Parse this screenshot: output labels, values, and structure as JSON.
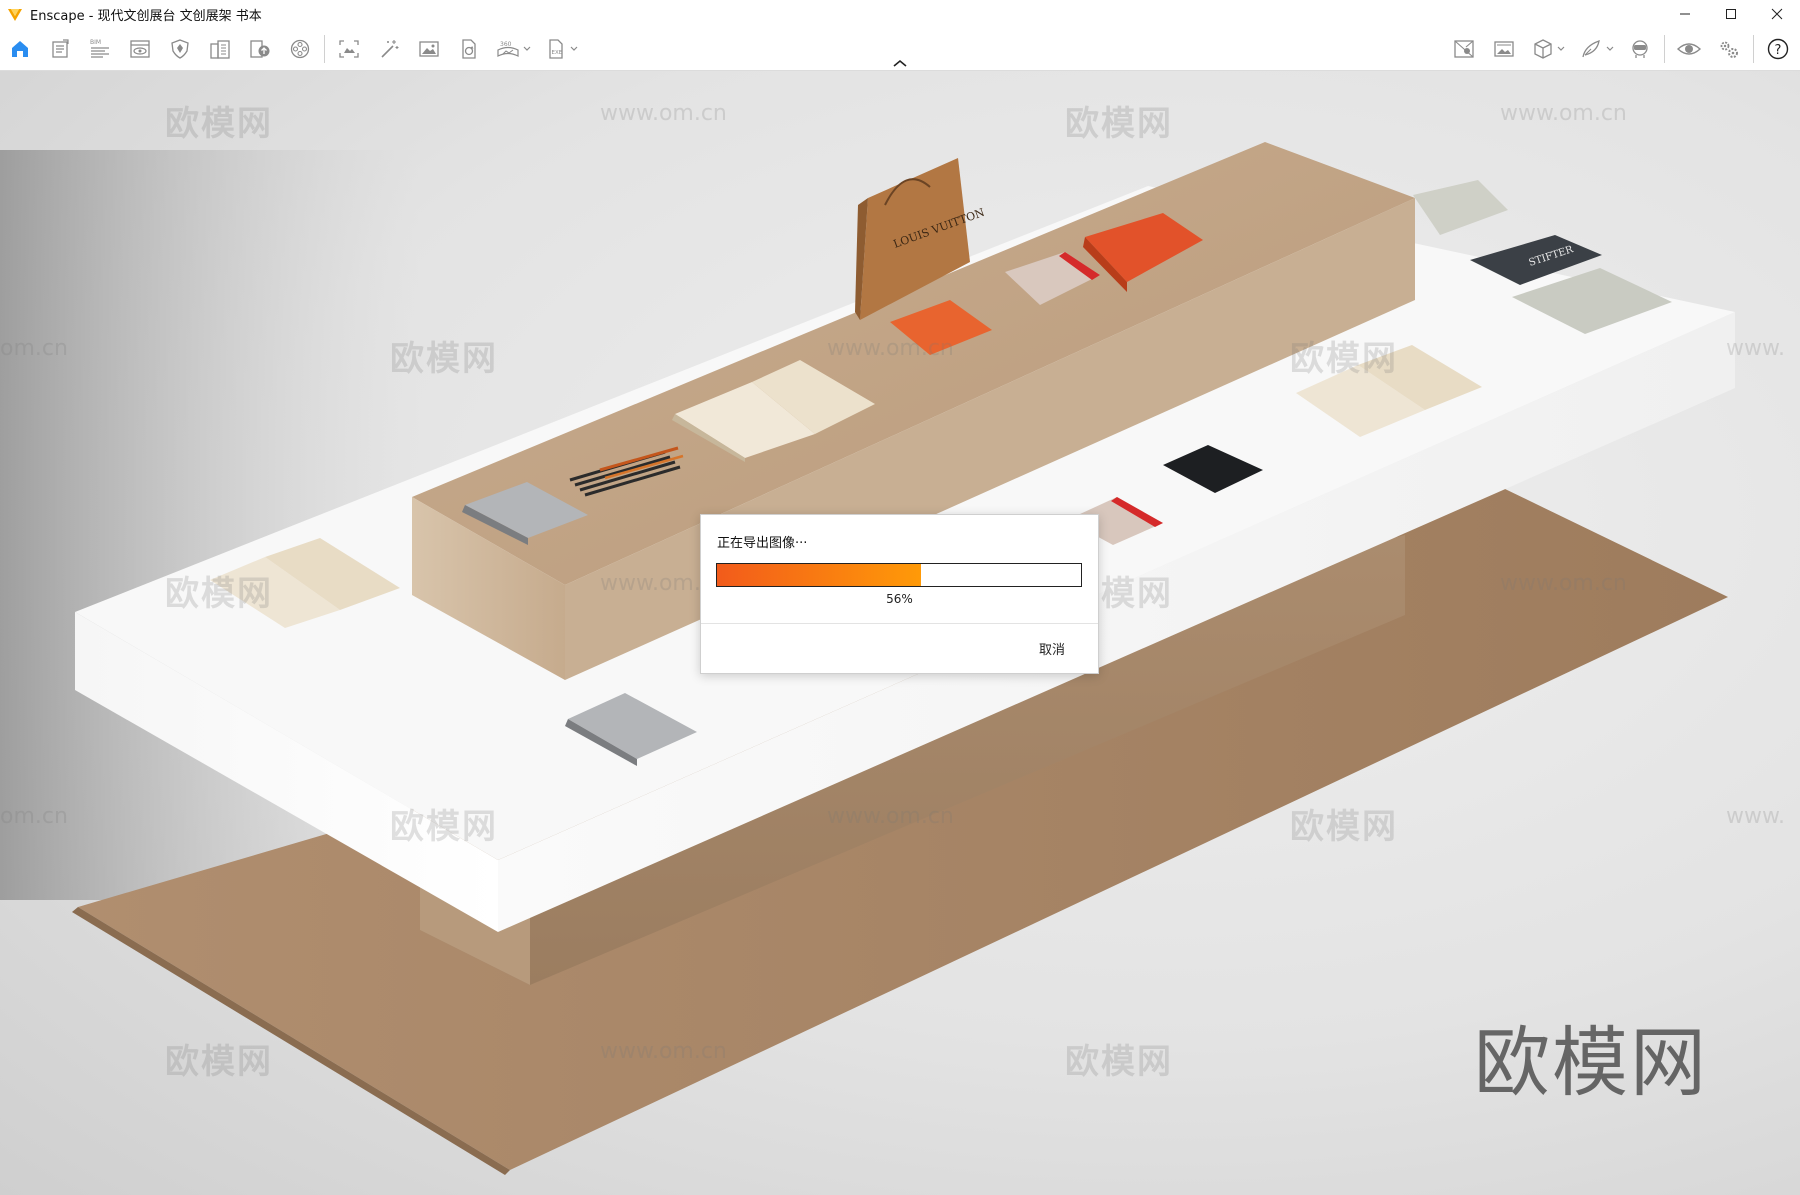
{
  "window": {
    "title": "Enscape - 现代文创展台 文创展架 书本",
    "controls": [
      "minimize",
      "maximize",
      "close"
    ]
  },
  "toolbar": {
    "left_tools": [
      {
        "name": "home",
        "icon": "home-icon",
        "active": true
      },
      {
        "name": "project-manager",
        "icon": "document-list-icon"
      },
      {
        "name": "bim-info",
        "icon": "bim-icon",
        "badge": "BIM"
      },
      {
        "name": "views",
        "icon": "eye-window-icon"
      },
      {
        "name": "asset-library",
        "icon": "shield-icon"
      },
      {
        "name": "materials",
        "icon": "building-icon"
      },
      {
        "name": "upload",
        "icon": "book-upload-icon"
      },
      {
        "name": "render-settings",
        "icon": "film-reel-icon"
      },
      {
        "name": "capture",
        "icon": "frame-capture-icon"
      },
      {
        "name": "magic",
        "icon": "magic-wand-icon"
      },
      {
        "name": "screenshot",
        "icon": "image-icon"
      },
      {
        "name": "batch-render",
        "icon": "file-refresh-icon"
      },
      {
        "name": "panorama-360",
        "icon": "panorama-360-icon",
        "badge": "360",
        "dropdown": true
      },
      {
        "name": "export-exe",
        "icon": "exe-file-icon",
        "badge": "EXE",
        "dropdown": true
      }
    ],
    "right_tools": [
      {
        "name": "site-context",
        "icon": "map-pin-icon"
      },
      {
        "name": "image-export",
        "icon": "picture-icon"
      },
      {
        "name": "view-mode",
        "icon": "cube-icon",
        "dropdown": true
      },
      {
        "name": "collaboration",
        "icon": "feather-icon",
        "dropdown": true
      },
      {
        "name": "vr-headset",
        "icon": "vr-person-icon"
      },
      {
        "name": "visual-settings",
        "icon": "eye-icon"
      },
      {
        "name": "general-settings",
        "icon": "gears-icon"
      },
      {
        "name": "help",
        "icon": "help-icon",
        "label": "?"
      }
    ]
  },
  "watermarks": {
    "brand": "欧模网",
    "url": "www.om.cn",
    "url_partial_left": "om.cn",
    "url_partial_right": "www."
  },
  "scene": {
    "bag_label": "LOUIS VUITTON",
    "book_label": "STIFTER"
  },
  "dialog": {
    "title": "正在导出图像···",
    "progress": 0.56,
    "progress_text": "56%",
    "cancel_label": "取消"
  },
  "colors": {
    "progress_start": "#f25b1b",
    "progress_end": "#ff9a08",
    "app_logo": "#f5a300",
    "home_active": "#2a8df0"
  }
}
